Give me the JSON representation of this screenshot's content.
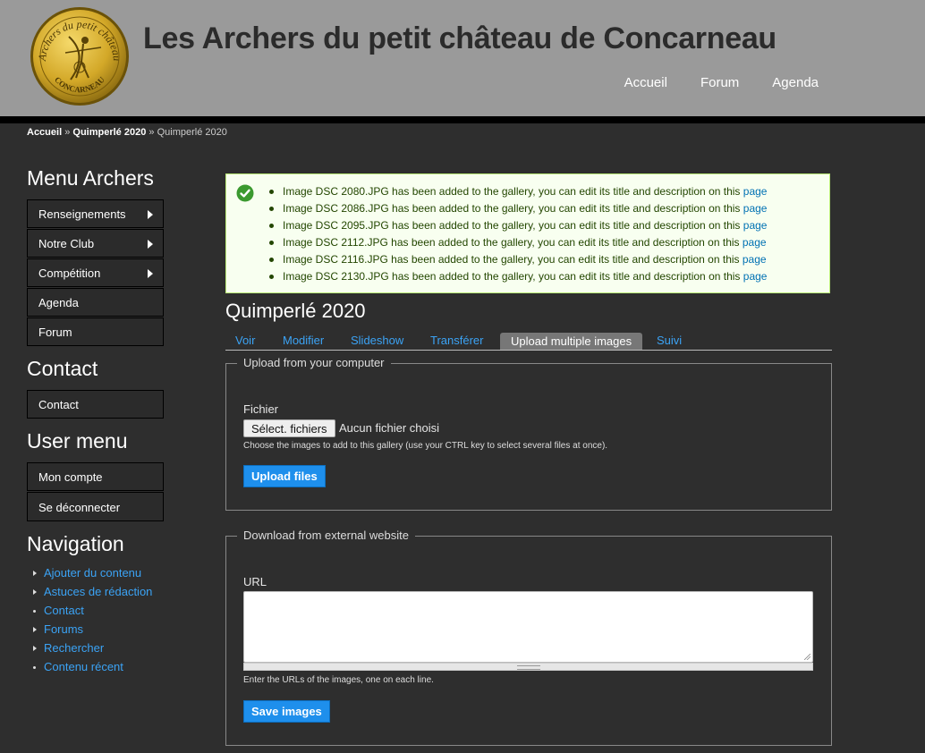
{
  "site": {
    "title": "Les Archers du petit château de Concarneau",
    "logo_top_text": "Archers du petit château",
    "logo_bottom_text": "CONCARNEAU",
    "nav": [
      "Accueil",
      "Forum",
      "Agenda"
    ]
  },
  "breadcrumb": {
    "home": "Accueil",
    "parent": "Quimperlé 2020",
    "current": "Quimperlé 2020",
    "separator": "»"
  },
  "sidebar": {
    "menu_title": "Menu Archers",
    "menu_items": [
      {
        "label": "Renseignements",
        "has_submenu": true
      },
      {
        "label": "Notre Club",
        "has_submenu": true
      },
      {
        "label": "Compétition",
        "has_submenu": true
      },
      {
        "label": "Agenda",
        "has_submenu": false
      },
      {
        "label": "Forum",
        "has_submenu": false
      }
    ],
    "contact_title": "Contact",
    "contact_items": [
      {
        "label": "Contact"
      }
    ],
    "user_title": "User menu",
    "user_items": [
      {
        "label": "Mon compte"
      },
      {
        "label": "Se déconnecter"
      }
    ],
    "nav_title": "Navigation",
    "nav_items": [
      {
        "label": "Ajouter du contenu",
        "marker": "arrow"
      },
      {
        "label": "Astuces de rédaction",
        "marker": "arrow"
      },
      {
        "label": "Contact",
        "marker": "dot"
      },
      {
        "label": "Forums",
        "marker": "arrow"
      },
      {
        "label": "Rechercher",
        "marker": "arrow"
      },
      {
        "label": "Contenu récent",
        "marker": "dot"
      }
    ]
  },
  "messages": {
    "status": "success",
    "link_text": "page",
    "items": [
      "Image DSC 2080.JPG has been added to the gallery, you can edit its title and description on this",
      "Image DSC 2086.JPG has been added to the gallery, you can edit its title and description on this",
      "Image DSC 2095.JPG has been added to the gallery, you can edit its title and description on this",
      "Image DSC 2112.JPG has been added to the gallery, you can edit its title and description on this",
      "Image DSC 2116.JPG has been added to the gallery, you can edit its title and description on this",
      "Image DSC 2130.JPG has been added to the gallery, you can edit its title and description on this"
    ]
  },
  "page": {
    "title": "Quimperlé 2020",
    "tabs": [
      "Voir",
      "Modifier",
      "Slideshow",
      "Transférer",
      "Upload multiple images",
      "Suivi"
    ],
    "active_tab": "Upload multiple images"
  },
  "upload": {
    "legend": "Upload from your computer",
    "file_label": "Fichier",
    "file_button": "Sélect. fichiers",
    "file_status": "Aucun fichier choisi",
    "description": "Choose the images to add to this gallery (use your CTRL key to select several files at once).",
    "submit": "Upload files"
  },
  "download": {
    "legend": "Download from external website",
    "url_label": "URL",
    "url_value": "",
    "description": "Enter the URLs of the images, one on each line.",
    "submit": "Save images"
  },
  "colors": {
    "header_bg": "#9a9a9a",
    "page_bg": "#2e2e2e",
    "link": "#3ba3f5",
    "button": "#1e8fec",
    "message_bg": "#f8fff0",
    "message_border": "#bbee77"
  }
}
